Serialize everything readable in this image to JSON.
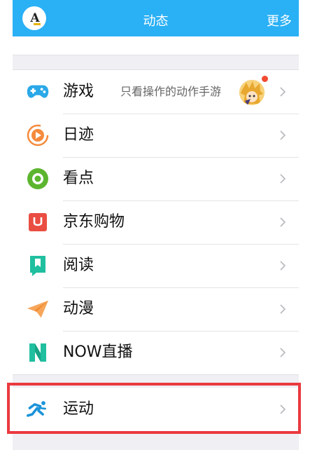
{
  "header": {
    "title": "动态",
    "more": "更多"
  },
  "list": [
    {
      "label": "游戏",
      "subtitle": "只看操作的动作手游",
      "icon": "gamepad-icon",
      "color": "#2aa8e8"
    },
    {
      "label": "日迹",
      "icon": "play-circle-icon",
      "color": "#f58a3c"
    },
    {
      "label": "看点",
      "icon": "eye-icon",
      "color": "#5cb52f"
    },
    {
      "label": "京东购物",
      "icon": "jd-shopping-icon",
      "color": "#ea4e43"
    },
    {
      "label": "阅读",
      "icon": "bookmark-book-icon",
      "color": "#1fbf9f"
    },
    {
      "label": "动漫",
      "icon": "paper-plane-icon",
      "color": "#f6a65b"
    },
    {
      "label": "NOW直播",
      "icon": "now-live-icon",
      "color": "#1fbf9f"
    }
  ],
  "sport": {
    "label": "运动",
    "icon": "running-icon",
    "color": "#1b93d9"
  },
  "colors": {
    "header": "#2ab0f5",
    "highlight": "#ea3a3f",
    "background": "#efeff4"
  }
}
